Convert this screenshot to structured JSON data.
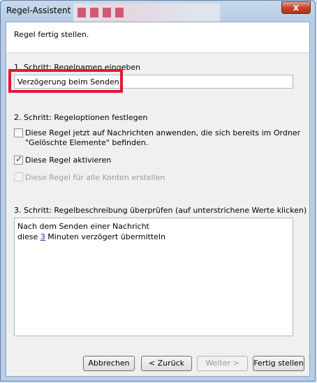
{
  "window": {
    "title": "Regel-Assistent",
    "close_label": "x"
  },
  "header": {
    "text": "Regel fertig stellen."
  },
  "step1": {
    "label": "1. Schritt: Regelnamen eingeben",
    "value": "Verzögerung beim Senden"
  },
  "step2": {
    "label": "2. Schritt: Regeloptionen festlegen",
    "option1_line1": "Diese Regel jetzt auf Nachrichten anwenden, die sich bereits im Ordner",
    "option1_line2": "\"Gelöschte Elemente\" befinden.",
    "option2": "Diese Regel aktivieren",
    "option3": "Diese Regel für alle Konten erstellen"
  },
  "step3": {
    "label": "3. Schritt: Regelbeschreibung überprüfen (auf unterstrichene Werte klicken)",
    "line1": "Nach dem Senden einer Nachricht",
    "line2_pre": "diese ",
    "line2_link": "3",
    "line2_post": " Minuten verzögert übermitteln"
  },
  "buttons": {
    "cancel": "Abbrechen",
    "back": "< Zurück",
    "next": "Weiter >",
    "finish": "Fertig stellen"
  }
}
